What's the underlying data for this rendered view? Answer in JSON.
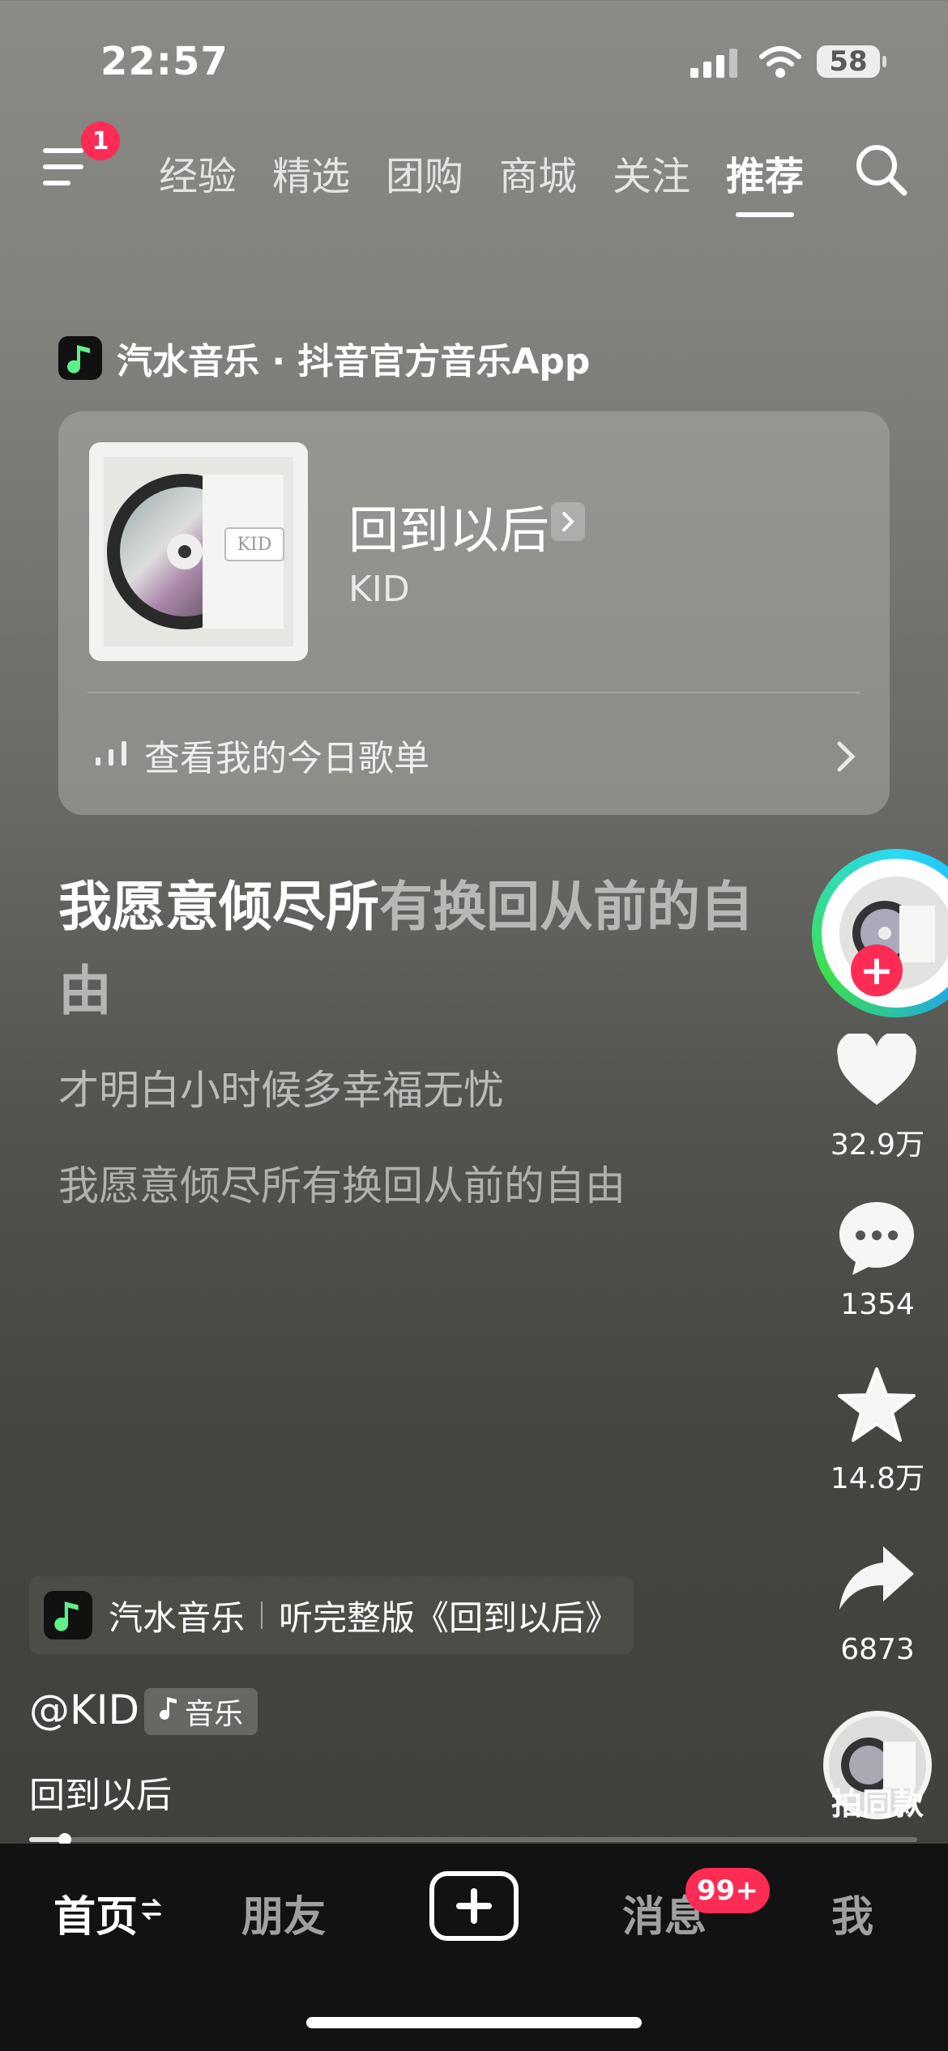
{
  "status_bar": {
    "time": "22:57",
    "battery": "58"
  },
  "top_nav": {
    "notification_count": "1",
    "tabs": [
      {
        "label": "经验"
      },
      {
        "label": "精选"
      },
      {
        "label": "团购"
      },
      {
        "label": "商城"
      },
      {
        "label": "关注"
      },
      {
        "label": "推荐",
        "active": true
      }
    ]
  },
  "music_card": {
    "source": "汽水音乐 · 抖音官方音乐App",
    "song_title": "回到以后",
    "artist": "KID",
    "playlist_link": "查看我的今日歌单",
    "album_text": "KID"
  },
  "lyrics": {
    "current_bright": "我愿意倾尽所",
    "current_dim": "有换回从前的自由",
    "next": "才明白小时候多幸福无忧",
    "following": "我愿意倾尽所有换回从前的自由"
  },
  "actions": {
    "likes": "32.9万",
    "comments": "1354",
    "favorites": "14.8万",
    "shares": "6873",
    "remix_label": "拍同款"
  },
  "video_info": {
    "chip_app": "汽水音乐",
    "chip_text": "听完整版《回到以后》",
    "author": "@KID",
    "tag": "音乐",
    "caption": "回到以后",
    "progress": 0.04
  },
  "bottom_nav": {
    "home": "首页",
    "friends": "朋友",
    "messages": "消息",
    "messages_badge": "99+",
    "me": "我"
  },
  "colors": {
    "accent": "#fe2c55",
    "bar": "#121212"
  }
}
